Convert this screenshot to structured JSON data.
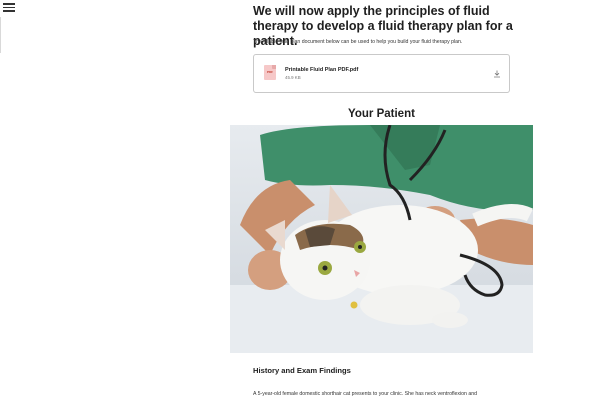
{
  "menu": {
    "icon": "hamburger-menu-icon"
  },
  "content": {
    "lead_title": "We will now apply the principles of fluid therapy to develop a fluid therapy plan for a patient.",
    "intro": "The fillable fluid plan document below can be used to help you build your fluid therapy plan.",
    "file": {
      "icon_label": "PDF",
      "name": "Printable Fluid Plan PDF.pdf",
      "size": "45.9 KB",
      "download_icon": "download-icon"
    },
    "section_title": "Your Patient",
    "subheading": "History and Exam Findings",
    "body_text": "A 5-year-old female domestic shorthair cat presents to your clinic. She has neck ventroflexion and"
  },
  "colors": {
    "scrub_green": "#3f8f6a",
    "pdf_icon": "#f6c8c8",
    "card_border": "#c9c9c9"
  }
}
